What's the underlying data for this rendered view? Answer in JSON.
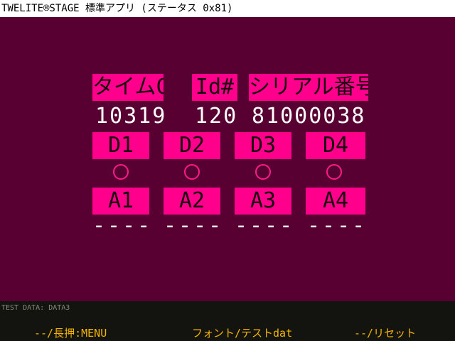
{
  "window": {
    "title": "TWELITE®STAGE 標準アプリ (ステータス 0x81)"
  },
  "headers": {
    "timect": "タイムCT",
    "id": "Id#",
    "serial": "シリアル番号"
  },
  "values": {
    "timect": "10319",
    "id": "120",
    "serial": "81000038"
  },
  "digital": [
    {
      "label": "D1",
      "state": "off"
    },
    {
      "label": "D2",
      "state": "off"
    },
    {
      "label": "D3",
      "state": "off"
    },
    {
      "label": "D4",
      "state": "off"
    }
  ],
  "analog": [
    {
      "label": "A1",
      "value": "----"
    },
    {
      "label": "A2",
      "value": "----"
    },
    {
      "label": "A3",
      "value": "----"
    },
    {
      "label": "A4",
      "value": "----"
    }
  ],
  "footer": {
    "test_data": "TEST DATA: DATA3",
    "left_button": "--/長押:MENU",
    "center_button": "フォント/テストdat",
    "right_button": "--/リセット"
  },
  "colors": {
    "background": "#590033",
    "label_bg": "#ff008c",
    "footer_text": "#f5b400",
    "footer_bg": "#13130f"
  }
}
